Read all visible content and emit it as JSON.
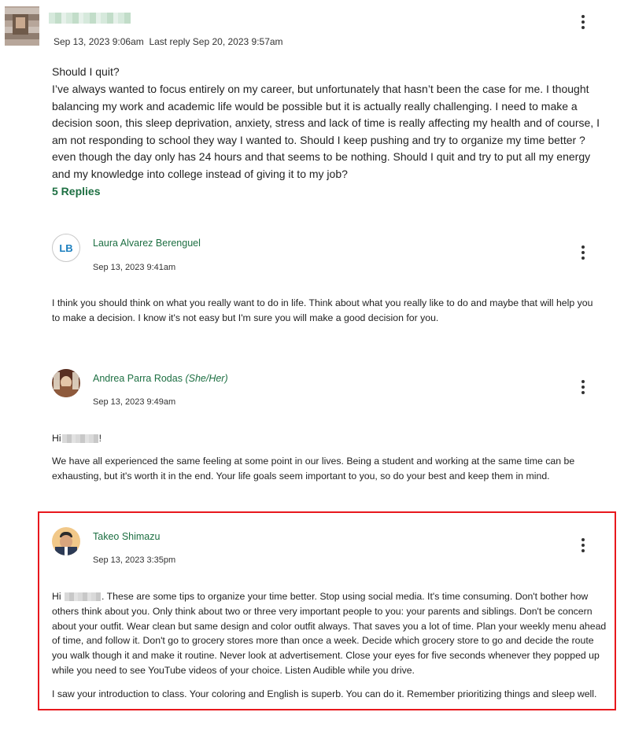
{
  "post": {
    "timestamp": "Sep 13, 2023 9:06am",
    "last_reply": "Last reply Sep 20, 2023 9:57am",
    "title": "Should I quit?",
    "body": "I’ve always wanted to focus entirely on my career, but unfortunately that hasn’t been the case for me. I thought balancing my work and academic life would be possible but it is actually really challenging. I need to make a decision soon, this sleep deprivation, anxiety, stress and lack of time is really affecting my health and of course, I am not responding to school they way I wanted to. Should I keep pushing and try to organize my time better ? even though the day only has 24 hours and that seems to be nothing. Should I quit and try to put all my energy and my knowledge into college instead of giving it to my job?",
    "replies_link": "5 Replies"
  },
  "replies": [
    {
      "initials": "LB",
      "author": "Laura Alvarez Berenguel",
      "date": "Sep 13, 2023 9:41am",
      "text": "I think you should think on what you really want to do in life. Think about what you really like to do and maybe that will help you to make a decision. I know it's not easy but I'm sure you will make a good decision for you."
    },
    {
      "author": "Andrea Parra Rodas",
      "pronouns": "(She/Her)",
      "date": "Sep 13, 2023 9:49am",
      "greeting_prefix": "Hi",
      "greeting_suffix": "!",
      "text": "We have all experienced the same feeling at some point in our lives. Being a student and working at the same time can be exhausting, but it's worth it in the end. Your life goals seem important to you, so do your best and keep them in mind."
    },
    {
      "author": "Takeo Shimazu",
      "date": "Sep 13, 2023 3:35pm",
      "greeting_prefix": "Hi",
      "text": ". These are some tips to organize your time better. Stop using social media. It's time consuming. Don't bother how others think about you. Only think about two or three very important people to you: your parents and siblings. Don't be concern about your outfit. Wear clean but same design and color outfit always. That saves you a lot of time. Plan your weekly menu ahead of time, and follow it. Don't go to grocery stores more than once a week. Decide which grocery store to go and decide the route you walk though it and make it routine. Never look at advertisement. Close your eyes for five seconds whenever they popped up while you need to see YouTube videos of your choice. Listen Audible while you drive.",
      "text2": "I saw your introduction to class. Your coloring and English is superb. You can do it. Remember prioritizing things and sleep well."
    }
  ],
  "colors": {
    "accent": "#1d6f42",
    "highlight_border": "#e8181d",
    "initials": "#1c7fbf"
  }
}
